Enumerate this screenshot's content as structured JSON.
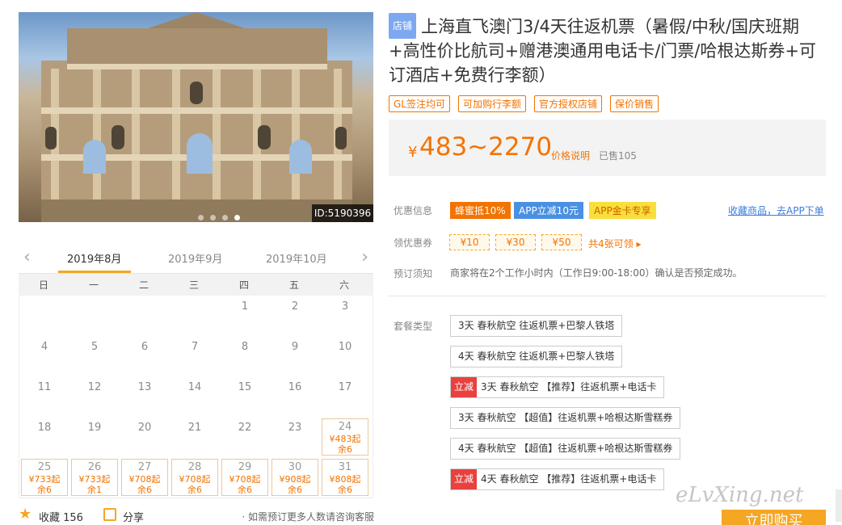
{
  "hero": {
    "id_tag": "ID:5190396",
    "slide_count": 4,
    "active_slide": 3
  },
  "calendar": {
    "prev_label": "‹",
    "next_label": "›",
    "months": [
      "2019年8月",
      "2019年9月",
      "2019年10月"
    ],
    "active_month": 0,
    "weekdays": [
      "日",
      "一",
      "二",
      "三",
      "四",
      "五",
      "六"
    ],
    "leading_blanks": 4,
    "days": [
      {
        "d": "1"
      },
      {
        "d": "2"
      },
      {
        "d": "3"
      },
      {
        "d": "4"
      },
      {
        "d": "5"
      },
      {
        "d": "6"
      },
      {
        "d": "7"
      },
      {
        "d": "8"
      },
      {
        "d": "9"
      },
      {
        "d": "10"
      },
      {
        "d": "11"
      },
      {
        "d": "12"
      },
      {
        "d": "13"
      },
      {
        "d": "14"
      },
      {
        "d": "15"
      },
      {
        "d": "16"
      },
      {
        "d": "17"
      },
      {
        "d": "18"
      },
      {
        "d": "19"
      },
      {
        "d": "20"
      },
      {
        "d": "21"
      },
      {
        "d": "22"
      },
      {
        "d": "23"
      },
      {
        "d": "24",
        "price": "¥483起",
        "left": "余6"
      },
      {
        "d": "25",
        "price": "¥733起",
        "left": "余6"
      },
      {
        "d": "26",
        "price": "¥733起",
        "left": "余1"
      },
      {
        "d": "27",
        "price": "¥708起",
        "left": "余6"
      },
      {
        "d": "28",
        "price": "¥708起",
        "left": "余6"
      },
      {
        "d": "29",
        "price": "¥708起",
        "left": "余6"
      },
      {
        "d": "30",
        "price": "¥908起",
        "left": "余6"
      },
      {
        "d": "31",
        "price": "¥808起",
        "left": "余6"
      }
    ]
  },
  "bottom": {
    "favorite": "收藏 156",
    "share": "分享",
    "note": "· 如需预订更多人数请咨询客服"
  },
  "product": {
    "shop_badge": "店铺",
    "title": "上海直飞澳门3/4天往返机票（暑假/中秋/国庆班期+高性价比航司+赠港澳通用电话卡/门票/哈根达斯券+可订酒店+免费行李额）",
    "tags": [
      "GL签注均可",
      "可加购行李额",
      "官方授权店铺",
      "保价销售"
    ],
    "price_symbol": "¥",
    "price_range": "483~2270",
    "price_explain": "价格说明",
    "sold": "已售105"
  },
  "promotions": {
    "label": "优惠信息",
    "items": [
      "蜂蜜抵10%",
      "APP立减10元",
      "APP金卡专享"
    ],
    "app_link": "收藏商品，去APP下单"
  },
  "coupons": {
    "label": "领优惠券",
    "items": [
      "¥10",
      "¥30",
      "¥50"
    ],
    "more": "共4张可领 ▸"
  },
  "booking": {
    "label": "预订须知",
    "notice": "商家将在2个工作小时内（工作日9:00-18:00）确认是否预定成功。"
  },
  "packages": {
    "label": "套餐类型",
    "badge": "立减",
    "items": [
      {
        "text": "3天 春秋航空 往返机票+巴黎人铁塔",
        "discount": false
      },
      {
        "text": "4天 春秋航空 往返机票+巴黎人铁塔",
        "discount": false
      },
      {
        "text": "3天 春秋航空 【推荐】往返机票+电话卡",
        "discount": true
      },
      {
        "text": "3天 春秋航空 【超值】往返机票+哈根达斯雪糕券",
        "discount": false
      },
      {
        "text": "4天 春秋航空 【超值】往返机票+哈根达斯雪糕券",
        "discount": false
      },
      {
        "text": "4天 春秋航空 【推荐】往返机票+电话卡",
        "discount": true
      }
    ]
  },
  "buy_button": "立即购买",
  "watermark": "eLvXing.net"
}
